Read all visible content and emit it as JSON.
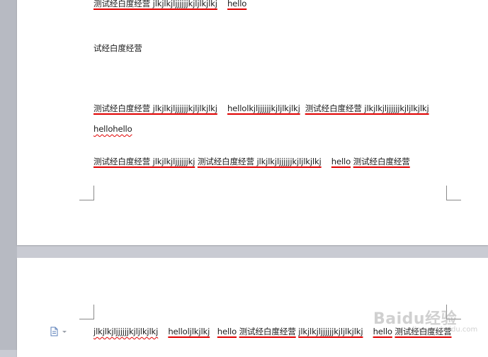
{
  "page1": {
    "line_top": [
      "测试经白度经营 jlkjlkjljjjjjjkjljlkjlkj",
      "hello"
    ],
    "line_plain": "试经白度经营",
    "para1": [
      "测试经白度经营 jlkjlkjljjjjjjkjljlkjlkj",
      "hellolkjljjjjjjkjljlkjlkj",
      "测试经白度经营 jlkjlkjljjjjjjkjljlkjlkj"
    ],
    "para1_line2": "hellohello",
    "para2": [
      "测试经白度经营 jlkjlkjljjjjjjkj",
      "测试经白度经营 jlkjlkjljjjjjjkjljlkjlkj",
      "hello",
      "测试经白度经营"
    ]
  },
  "page2": {
    "line": [
      "jlkjlkjljjjjjjkjljlkjlkj",
      "helloljlkjlkj",
      "hello",
      "测试经白度经营",
      "jlkjlkjljjjjjjkjljlkjlkj",
      "hello",
      "测试经白度经营"
    ]
  },
  "watermark": {
    "logo": "Baidu经验",
    "sub": "jingyan.baidu.com"
  },
  "icons": {
    "doc": "document-icon",
    "dropdown": "chevron-down-icon"
  },
  "colors": {
    "underline": "#e00000",
    "page": "#ffffff",
    "background": "#c9cbd3"
  }
}
